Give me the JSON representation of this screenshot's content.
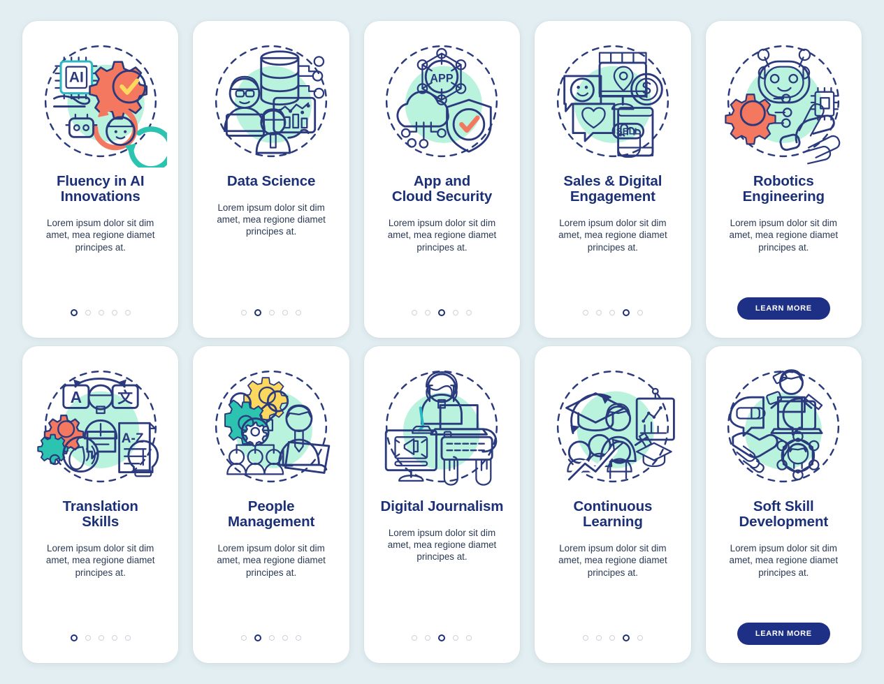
{
  "page": {
    "background_color": "#e2eef1",
    "card_color": "#ffffff",
    "title_color": "#1c3078",
    "accent_navy": "#1e2f86",
    "palette": {
      "orange": "#f4775f",
      "teal": "#2cc3b0",
      "cyan": "#2bb8c4",
      "yellow": "#fcd85e",
      "mint": "#b8f0dd",
      "navy_outline": "#2a3a7c",
      "dot_inactive": "#c9d2db"
    },
    "layout": {
      "columns": 5,
      "rows": 2,
      "total_cards": 10
    }
  },
  "common": {
    "body_text": "Lorem ipsum dolor sit dim amet, mea regione diamet principes at.",
    "learn_more_label": "LEARN MORE",
    "dots_count": 5
  },
  "cards": [
    {
      "id": "fluency-in-ai-innovations",
      "title_line1": "Fluency in AI",
      "title_line2": "Innovations",
      "body": "Lorem ipsum dolor sit dim amet, mea regione diamet principes at.",
      "active_dot": 1,
      "has_button": false,
      "icon_name": "ai-innovation-icon",
      "icon_elements": [
        "ai-chip",
        "hand",
        "orange-gear-check",
        "robot-head",
        "human-face",
        "cycle-arrows"
      ]
    },
    {
      "id": "data-science",
      "title_line1": "Data Science",
      "title_line2": "",
      "body": "Lorem ipsum dolor sit dim amet, mea regione diamet principes at.",
      "active_dot": 2,
      "has_button": false,
      "icon_name": "data-science-icon",
      "icon_elements": [
        "database-cylinder",
        "node-tree",
        "analyst-with-laptop",
        "bar-chart-board",
        "presenter"
      ]
    },
    {
      "id": "app-and-cloud-security",
      "title_line1": "App and",
      "title_line2": "Cloud Security",
      "body": "Lorem ipsum dolor sit dim amet, mea regione diamet principes at.",
      "active_dot": 3,
      "has_button": false,
      "icon_name": "app-cloud-security-icon",
      "icon_label_text": "APP",
      "icon_elements": [
        "app-node-hexagon",
        "cloud",
        "circuit-dots",
        "teal-shield-check"
      ]
    },
    {
      "id": "sales-and-digital-engagement",
      "title_line1": "Sales & Digital",
      "title_line2": "Engagement",
      "body": "Lorem ipsum dolor sit dim amet, mea regione diamet principes at.",
      "active_dot": 4,
      "has_button": false,
      "icon_name": "sales-digital-engagement-icon",
      "icon_label_text": "SELL",
      "icon_elements": [
        "storefront-monitor",
        "location-pin",
        "dollar-coin",
        "smiley-speech-bubble",
        "heart-speech-bubble",
        "phone-sell-button",
        "cursor-hand"
      ]
    },
    {
      "id": "robotics-engineering",
      "title_line1": "Robotics",
      "title_line2": "Engineering",
      "body": "Lorem ipsum dolor sit dim amet, mea regione diamet principes at.",
      "active_dot": 0,
      "has_button": true,
      "icon_name": "robotics-engineering-icon",
      "icon_elements": [
        "robot-head-antennae",
        "orange-gear",
        "robotic-hand",
        "microchip",
        "circuit-dots"
      ]
    },
    {
      "id": "translation-skills",
      "title_line1": "Translation",
      "title_line2": "Skills",
      "body": "Lorem ipsum dolor sit dim amet, mea regione diamet principes at.",
      "active_dot": 1,
      "has_button": false,
      "icon_name": "translation-skills-icon",
      "icon_label_a": "A",
      "icon_label_cjk": "文",
      "icon_label_az": "A-Z",
      "icon_elements": [
        "letter-a-card",
        "cjk-card",
        "swap-arrow",
        "person",
        "gears",
        "speaking-head",
        "az-document",
        "lightbulb"
      ]
    },
    {
      "id": "people-management",
      "title_line1": "People",
      "title_line2": "Management",
      "body": "Lorem ipsum dolor sit dim amet, mea regione diamet principes at.",
      "active_dot": 2,
      "has_button": false,
      "icon_name": "people-management-icon",
      "icon_elements": [
        "gears",
        "team-figures",
        "org-chart",
        "manager-with-clipboard"
      ]
    },
    {
      "id": "digital-journalism",
      "title_line1": "Digital Journalism",
      "title_line2": "",
      "body": "Lorem ipsum dolor sit dim amet, mea regione diamet principes at.",
      "active_dot": 3,
      "has_button": false,
      "icon_name": "digital-journalism-icon",
      "icon_elements": [
        "writer-with-laptop",
        "monitor-megaphone",
        "keyboard-with-hands"
      ]
    },
    {
      "id": "continuous-learning",
      "title_line1": "Continuous",
      "title_line2": "Learning",
      "body": "Lorem ipsum dolor sit dim amet, mea regione diamet principes at.",
      "active_dot": 4,
      "has_button": false,
      "icon_name": "continuous-learning-icon",
      "icon_elements": [
        "graduation-cap",
        "cycle-arrow",
        "teacher-with-board",
        "audience",
        "growth-arrow"
      ]
    },
    {
      "id": "soft-skill-development",
      "title_line1": "Soft Skill",
      "title_line2": "Development",
      "body": "Lorem ipsum dolor sit dim amet, mea regione diamet principes at.",
      "active_dot": 0,
      "has_button": true,
      "icon_name": "soft-skill-development-icon",
      "icon_elements": [
        "handshake",
        "speech-bubbles",
        "multitasking-person",
        "laptop",
        "person-network-hexagon"
      ]
    }
  ]
}
